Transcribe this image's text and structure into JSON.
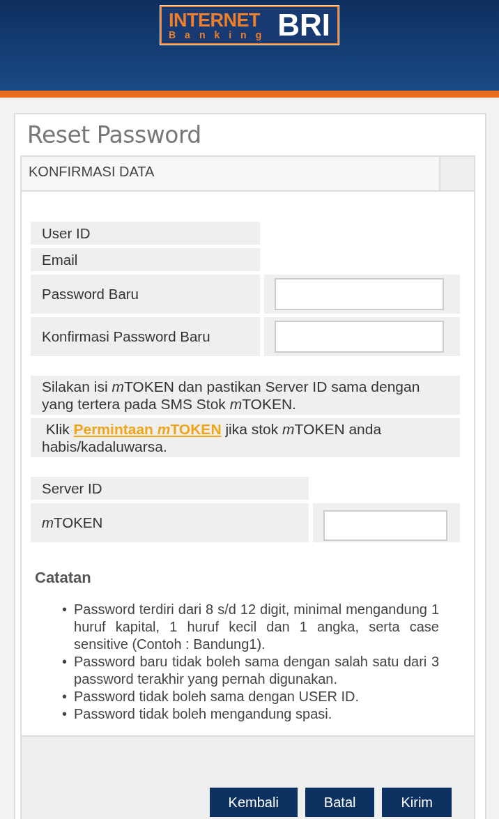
{
  "logo": {
    "line1": "INTERNET",
    "line2": "Banking",
    "brand": "BRI"
  },
  "title": "Reset Password",
  "section": "KONFIRMASI DATA",
  "info_rows": [
    {
      "kind": "text",
      "label": [
        {
          "italic": false,
          "text": "User ID"
        }
      ]
    },
    {
      "kind": "text",
      "label": [
        {
          "italic": false,
          "text": "Email"
        }
      ]
    },
    {
      "kind": "input",
      "label": [
        {
          "italic": false,
          "text": "Password Baru"
        }
      ]
    },
    {
      "kind": "input",
      "label": [
        {
          "italic": false,
          "text": "Konfirmasi Password Baru"
        }
      ]
    }
  ],
  "notice": [
    {
      "italic": false,
      "text": "Silakan isi "
    },
    {
      "italic": true,
      "text": "m"
    },
    {
      "italic": false,
      "text": "TOKEN dan pastikan Server ID sama dengan yang tertera pada SMS Stok "
    },
    {
      "italic": true,
      "text": "m"
    },
    {
      "italic": false,
      "text": "TOKEN."
    }
  ],
  "request": {
    "before": "Klik",
    "link": [
      {
        "italic": false,
        "text": "Permintaan "
      },
      {
        "italic": true,
        "text": "m"
      },
      {
        "italic": false,
        "text": "TOKEN"
      }
    ],
    "after": [
      {
        "italic": false,
        "text": "jika stok "
      },
      {
        "italic": true,
        "text": "m"
      },
      {
        "italic": false,
        "text": "TOKEN anda habis/kadaluwarsa."
      }
    ]
  },
  "token_rows": [
    {
      "kind": "text",
      "label": [
        {
          "italic": false,
          "text": "Server ID"
        }
      ]
    },
    {
      "kind": "input",
      "label": [
        {
          "italic": true,
          "text": "m"
        },
        {
          "italic": false,
          "text": "TOKEN"
        }
      ]
    }
  ],
  "notes": {
    "title": "Catatan",
    "marker": "•",
    "items": [
      "Password terdiri dari 8 s/d 12 digit, minimal mengandung 1 huruf kapital, 1 huruf kecil dan 1 angka, serta case sensitive (Contoh : Bandung1).",
      "Password baru tidak boleh sama dengan salah satu dari 3 password terakhir yang pernah digunakan.",
      "Password tidak boleh sama dengan USER ID.",
      "Password tidak boleh mengandung spasi."
    ]
  },
  "buttons": [
    "Kembali",
    "Batal",
    "Kirim"
  ]
}
